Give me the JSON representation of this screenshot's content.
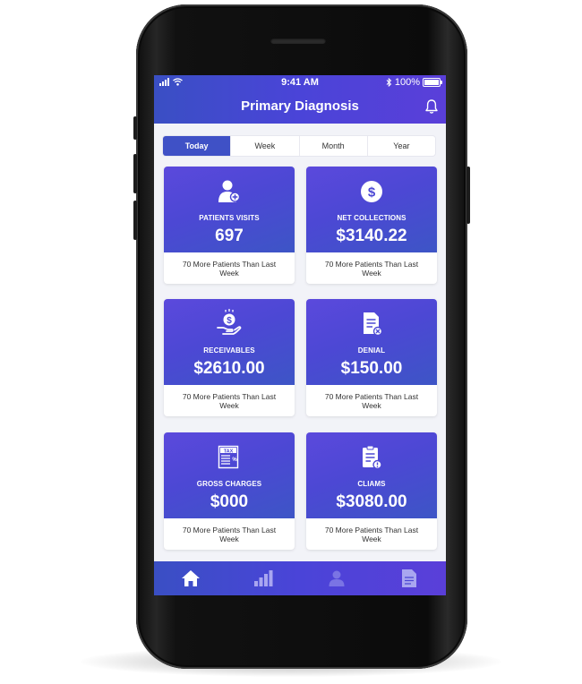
{
  "status_bar": {
    "time": "9:41 AM",
    "battery": "100%",
    "battery_level": 1.0
  },
  "header": {
    "title": "Primary Diagnosis"
  },
  "tabs": [
    {
      "label": "Today",
      "active": true
    },
    {
      "label": "Week",
      "active": false
    },
    {
      "label": "Month",
      "active": false
    },
    {
      "label": "Year",
      "active": false
    }
  ],
  "cards": [
    {
      "icon": "patient-add-icon",
      "label": "PATIENTS VISITS",
      "value": "697",
      "footer": "70 More Patients Than Last Week"
    },
    {
      "icon": "dollar-circle-icon",
      "label": "NET COLLECTIONS",
      "value": "$3140.22",
      "footer": "70 More Patients Than Last Week"
    },
    {
      "icon": "money-hand-icon",
      "label": "RECEIVABLES",
      "value": "$2610.00",
      "footer": "70 More Patients Than Last Week"
    },
    {
      "icon": "document-denied-icon",
      "label": "DENIAL",
      "value": "$150.00",
      "footer": "70 More Patients Than Last Week"
    },
    {
      "icon": "tax-form-icon",
      "label": "GROSS CHARGES",
      "value": "$000",
      "footer": "70 More Patients Than Last Week"
    },
    {
      "icon": "clipboard-alert-icon",
      "label": "CLIAMS",
      "value": "$3080.00",
      "footer": "70 More Patients Than Last Week"
    }
  ],
  "bottom_nav": [
    {
      "icon": "home-icon",
      "active": true
    },
    {
      "icon": "bar-chart-icon",
      "active": false
    },
    {
      "icon": "user-icon",
      "active": false
    },
    {
      "icon": "document-icon",
      "active": false
    }
  ],
  "colors": {
    "primary": "#4a44d8",
    "active_tab": "#3f51c6",
    "background": "#f2f3f8"
  }
}
